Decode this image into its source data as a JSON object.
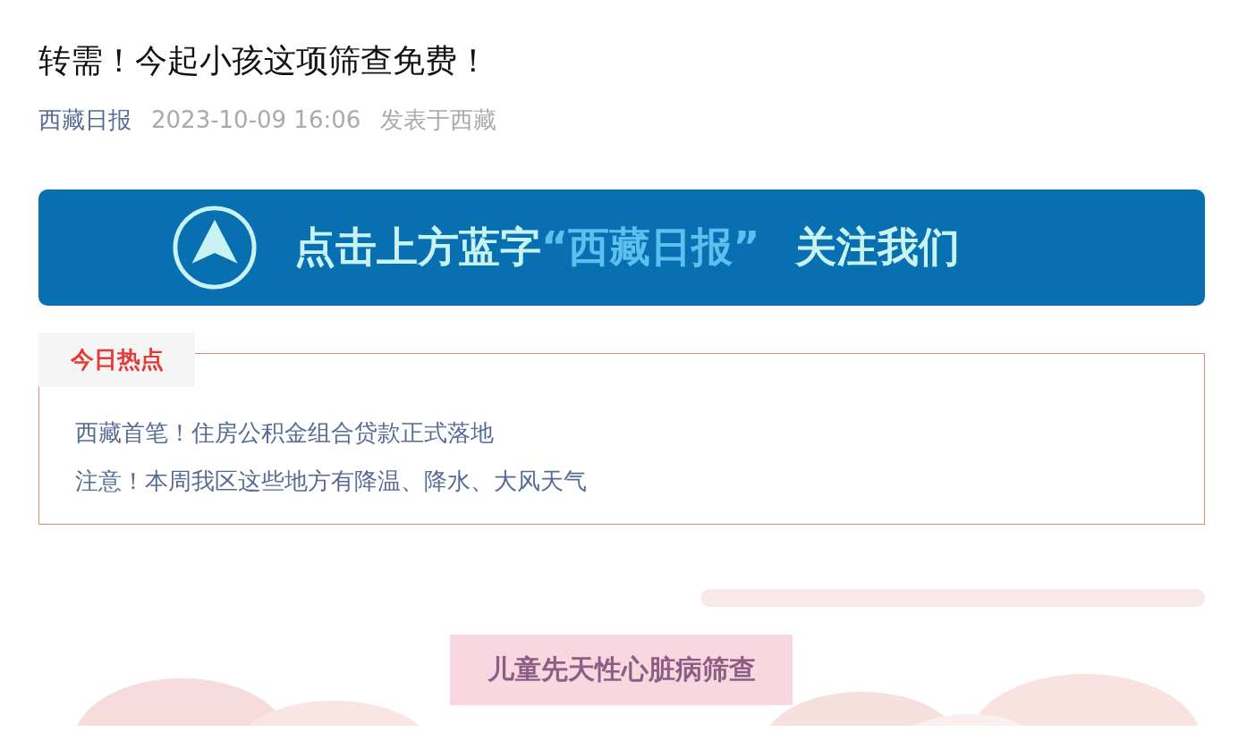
{
  "article": {
    "title": "转需！今起小孩这项筛查免费！",
    "source": "西藏日报",
    "datetime": "2023-10-09 16:06",
    "location": "发表于西藏"
  },
  "banner": {
    "prefix": "点击上方蓝字",
    "account": "“西藏日报”",
    "suffix": "关注我们"
  },
  "hot_topics": {
    "heading": "今日热点",
    "items": [
      "西藏首笔！住房公积金组合贷款正式落地",
      "注意！本周我区这些地方有降温、降水、大风天气"
    ]
  },
  "figure": {
    "kind": "picture",
    "caption": "儿童先天性心脏病筛查"
  }
}
